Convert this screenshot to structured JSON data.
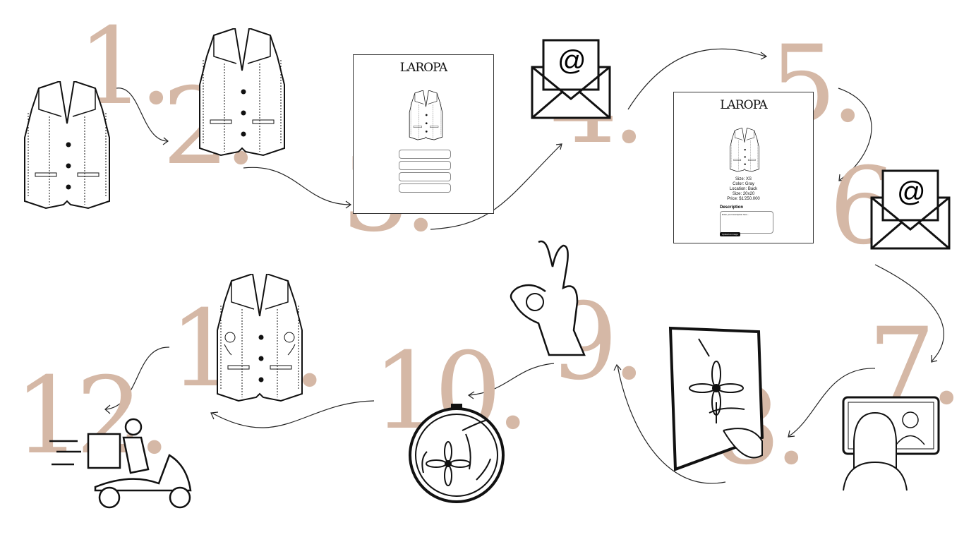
{
  "steps": [
    "1.",
    "2.",
    "3.",
    "4.",
    "5.",
    "6.",
    "7.",
    "8.",
    "9.",
    "10.",
    "11.",
    "12."
  ],
  "colors": {
    "number": "#d5b8a6",
    "line": "#111111"
  },
  "form_card": {
    "logo": "LAROPA"
  },
  "product_card": {
    "logo": "LAROPA",
    "details": [
      "Size: XS",
      "Color: Gray",
      "Location: Back",
      "Size: 20x20",
      "Price: $1'250.000"
    ],
    "description_label": "Description",
    "description_placeholder": "Enter your description here...",
    "upload_button": "Upload an image"
  },
  "envelope_symbol": "@",
  "icons": [
    "vest-icon",
    "envelope-icon",
    "video-call-icon",
    "embroidery-pattern-icon",
    "ok-hand-icon",
    "embroidery-hoop-icon",
    "embroidered-vest-icon",
    "delivery-scooter-icon"
  ]
}
